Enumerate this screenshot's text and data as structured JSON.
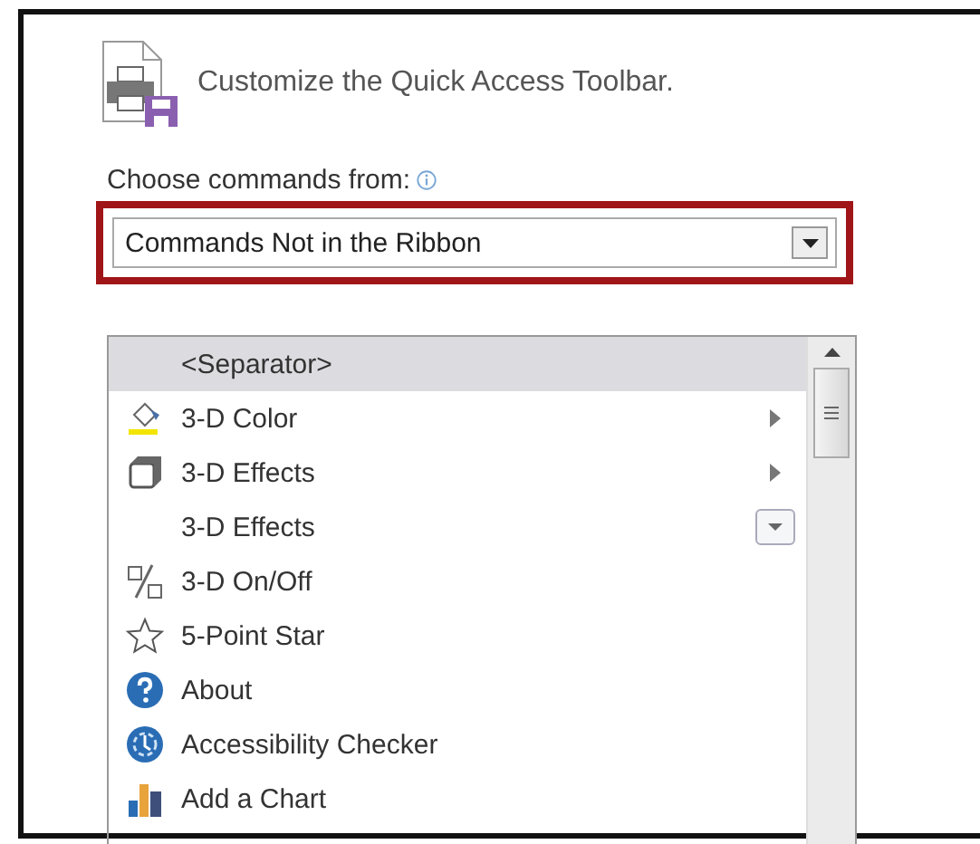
{
  "heading": "Customize the Quick Access Toolbar.",
  "choose_label": "Choose commands from:",
  "dropdown": {
    "value": "Commands Not in the Ribbon",
    "highlighted": true
  },
  "commands": [
    {
      "label": "<Separator>",
      "selected": true,
      "kind": "plain"
    },
    {
      "label": "3-D Color",
      "selected": false,
      "kind": "submenu"
    },
    {
      "label": "3-D Effects",
      "selected": false,
      "kind": "submenu"
    },
    {
      "label": "3-D Effects",
      "selected": false,
      "kind": "dropdown"
    },
    {
      "label": "3-D On/Off",
      "selected": false,
      "kind": "plain"
    },
    {
      "label": "5-Point Star",
      "selected": false,
      "kind": "plain"
    },
    {
      "label": "About",
      "selected": false,
      "kind": "plain"
    },
    {
      "label": "Accessibility Checker",
      "selected": false,
      "kind": "plain"
    },
    {
      "label": "Add a Chart",
      "selected": false,
      "kind": "plain"
    }
  ]
}
